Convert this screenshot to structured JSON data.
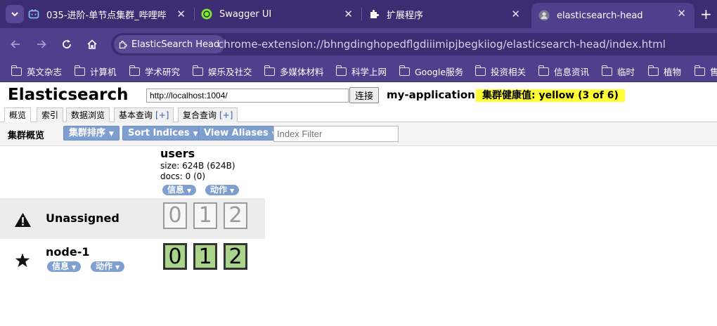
{
  "browser": {
    "tabs": [
      {
        "title": "035-进阶-单节点集群_哔哩哔哩",
        "favicon": "bilibili-icon",
        "active": false
      },
      {
        "title": "Swagger UI",
        "favicon": "swagger-icon",
        "active": false
      },
      {
        "title": "扩展程序",
        "favicon": "puzzle-icon",
        "active": false
      },
      {
        "title": "elasticsearch-head",
        "favicon": "extension-page-icon",
        "active": true
      }
    ],
    "chip_label": "ElasticSearch Head",
    "url": "chrome-extension://bhngdinghopedflgdiiimipjbegkiiog/elasticsearch-head/index.html",
    "bookmarks": [
      "英文杂志",
      "计算机",
      "学术研究",
      "娱乐及社交",
      "多媒体材料",
      "科学上网",
      "Google服务",
      "投资相关",
      "信息资讯",
      "临时",
      "植物",
      "售"
    ]
  },
  "app": {
    "title": "Elasticsearch",
    "connect_url": "http://localhost:1004/",
    "connect_label": "连接",
    "cluster_name": "my-application",
    "health_text": "集群健康值: yellow (3 of 6)",
    "health_color": "#ffff33",
    "tabs": [
      {
        "label": "概览",
        "plus": ""
      },
      {
        "label": "索引",
        "plus": ""
      },
      {
        "label": "数据浏览",
        "plus": ""
      },
      {
        "label": "基本查询",
        "plus": "[+]"
      },
      {
        "label": "复合查询",
        "plus": "[+]"
      }
    ],
    "toolbar": {
      "label": "集群概览",
      "sort_cluster": "集群排序",
      "sort_indices": "Sort Indices",
      "view_aliases": "View Aliases",
      "filter_placeholder": "Index Filter"
    },
    "index": {
      "name": "users",
      "size": "size: 624B (624B)",
      "docs": "docs: 0 (0)",
      "info_label": "信息",
      "action_label": "动作"
    },
    "unassigned": {
      "label": "Unassigned",
      "shards": [
        "0",
        "1",
        "2"
      ]
    },
    "node": {
      "name": "node-1",
      "info_label": "信息",
      "action_label": "动作",
      "shards": [
        "0",
        "1",
        "2"
      ]
    },
    "colors": {
      "button": "#7f9fd0",
      "assigned_shard": "#a9d58a",
      "chrome_dark": "#3d2c72",
      "chrome": "#4f3f8c"
    }
  }
}
